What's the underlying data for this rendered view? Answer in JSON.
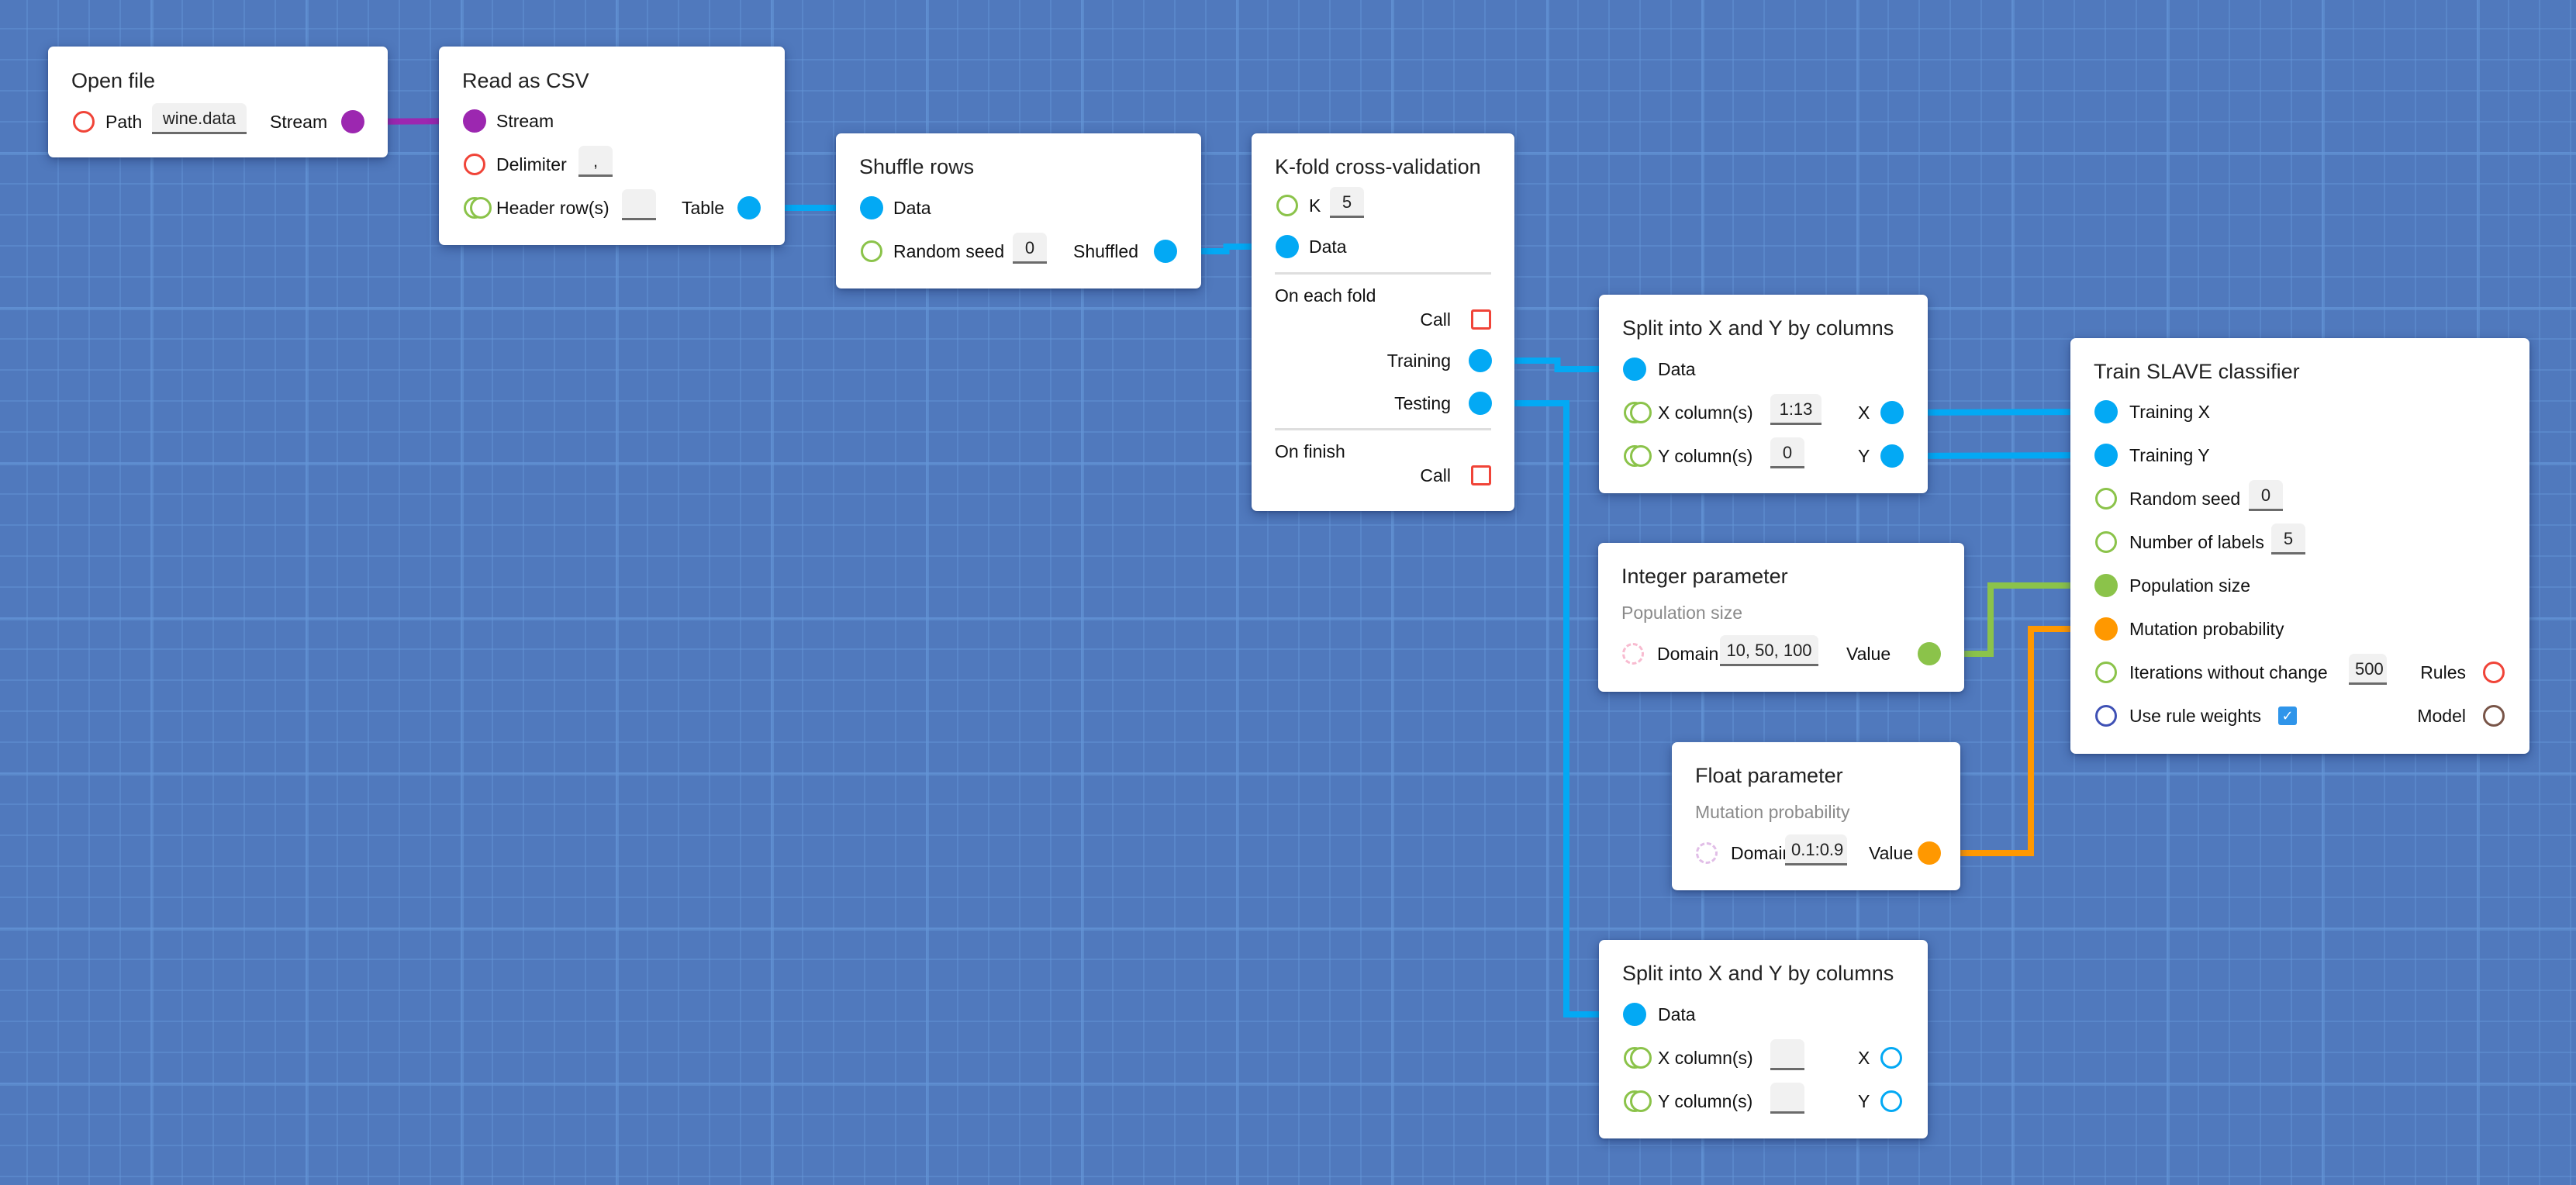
{
  "canvas": {
    "background": "#5079bd",
    "grid_line_color": "#5e8bc9"
  },
  "colors": {
    "stream": "#9c27b0",
    "data": "#03a9f4",
    "integer": "#8bc34a",
    "float": "#ff9800",
    "error_red": "#f04438",
    "bool_blue": "#3f51b5",
    "model_brown": "#795548",
    "domain_pink": "#f8bbd0",
    "domain_violet": "#e1bee7",
    "checkbox_blue": "#2f95ea"
  },
  "nodes": {
    "open_file": {
      "title": "Open file",
      "path_label": "Path",
      "path_value": "wine.data",
      "stream_label": "Stream"
    },
    "read_csv": {
      "title": "Read as CSV",
      "stream_label": "Stream",
      "delimiter_label": "Delimiter",
      "delimiter_value": ",",
      "header_label": "Header row(s)",
      "header_value": "",
      "table_label": "Table"
    },
    "shuffle": {
      "title": "Shuffle rows",
      "data_label": "Data",
      "seed_label": "Random seed",
      "seed_value": "0",
      "shuffled_label": "Shuffled"
    },
    "kfold": {
      "title": "K-fold cross-validation",
      "k_label": "K",
      "k_value": "5",
      "data_label": "Data",
      "each_fold_label": "On each fold",
      "call_label": "Call",
      "training_label": "Training",
      "testing_label": "Testing",
      "finish_label": "On finish",
      "finish_call_label": "Call"
    },
    "split_1": {
      "title": "Split into X and Y by columns",
      "data_label": "Data",
      "x_cols_label": "X column(s)",
      "x_cols_value": "1:13",
      "y_cols_label": "Y column(s)",
      "y_cols_value": "0",
      "x_label": "X",
      "y_label": "Y"
    },
    "split_2": {
      "title": "Split into X and Y by columns",
      "data_label": "Data",
      "x_cols_label": "X column(s)",
      "x_cols_value": "",
      "y_cols_label": "Y column(s)",
      "y_cols_value": "",
      "x_label": "X",
      "y_label": "Y"
    },
    "integer_param": {
      "title": "Integer parameter",
      "subtitle": "Population size",
      "domain_label": "Domain",
      "domain_value": "10, 50, 100",
      "value_label": "Value"
    },
    "float_param": {
      "title": "Float parameter",
      "subtitle": "Mutation probability",
      "domain_label": "Domain",
      "domain_value": "0.1:0.9",
      "value_label": "Value"
    },
    "train_slave": {
      "title": "Train SLAVE classifier",
      "training_x_label": "Training X",
      "training_y_label": "Training Y",
      "seed_label": "Random seed",
      "seed_value": "0",
      "labels_label": "Number of labels",
      "labels_value": "5",
      "population_label": "Population size",
      "mutation_label": "Mutation probability",
      "iterations_label": "Iterations without change",
      "iterations_value": "500",
      "rules_label": "Rules",
      "weights_label": "Use rule weights",
      "weights_checked": true,
      "weights_check_glyph": "✓",
      "model_label": "Model"
    }
  },
  "connections": [
    {
      "from": "open_file.stream",
      "to": "read_csv.stream",
      "type": "stream"
    },
    {
      "from": "read_csv.table",
      "to": "shuffle.data",
      "type": "data"
    },
    {
      "from": "shuffle.shuffled",
      "to": "kfold.data",
      "type": "data"
    },
    {
      "from": "kfold.training",
      "to": "split_1.data",
      "type": "data"
    },
    {
      "from": "kfold.testing",
      "to": "split_2.data",
      "type": "data"
    },
    {
      "from": "split_1.x",
      "to": "train_slave.training_x",
      "type": "data"
    },
    {
      "from": "split_1.y",
      "to": "train_slave.training_y",
      "type": "data"
    },
    {
      "from": "integer_param.value",
      "to": "train_slave.population",
      "type": "integer"
    },
    {
      "from": "float_param.value",
      "to": "train_slave.mutation",
      "type": "float"
    }
  ]
}
